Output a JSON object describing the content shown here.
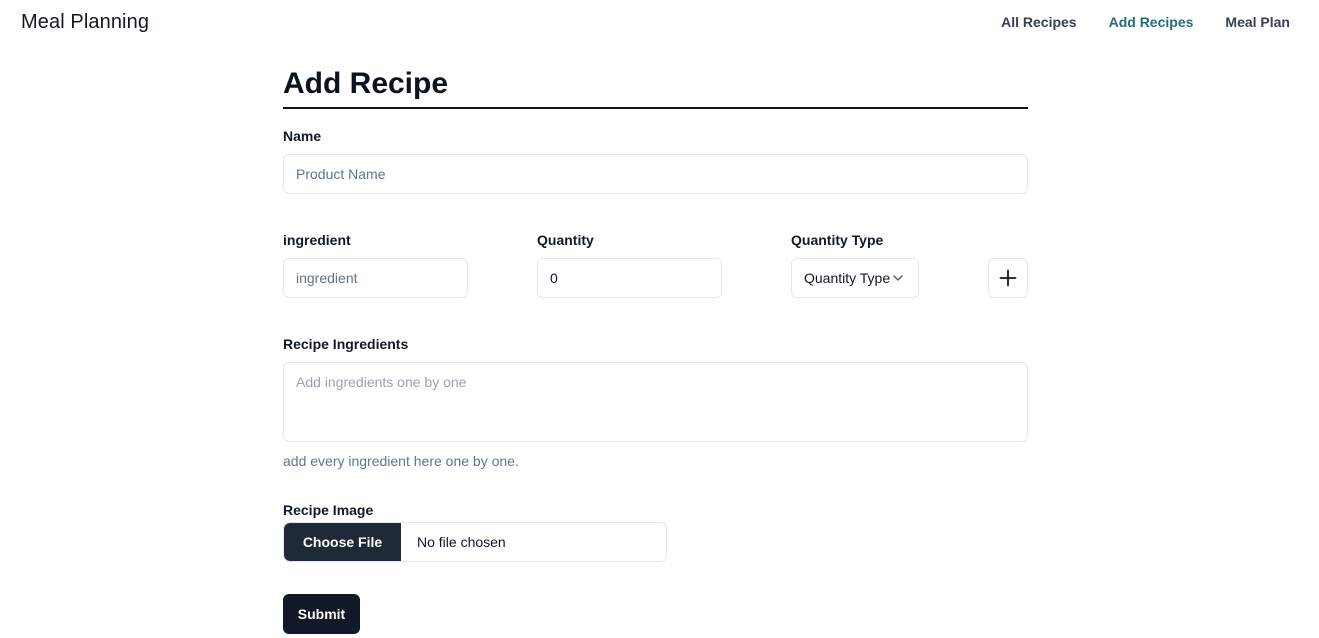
{
  "header": {
    "brand": "Meal Planning",
    "nav": [
      {
        "label": "All Recipes",
        "active": false
      },
      {
        "label": "Add Recipes",
        "active": true
      },
      {
        "label": "Meal Plan",
        "active": false
      }
    ]
  },
  "form": {
    "title": "Add Recipe",
    "name": {
      "label": "Name",
      "placeholder": "Product Name",
      "value": ""
    },
    "ingredient": {
      "label": "ingredient",
      "placeholder": "ingredient",
      "value": ""
    },
    "quantity": {
      "label": "Quantity",
      "value": "0"
    },
    "quantity_type": {
      "label": "Quantity Type",
      "selected": "Quantity Type"
    },
    "add_button_icon": "plus-icon",
    "recipe_ingredients": {
      "label": "Recipe Ingredients",
      "placeholder": "Add ingredients one by one",
      "help": "add every ingredient here one by one."
    },
    "recipe_image": {
      "label": "Recipe Image",
      "button": "Choose File",
      "status": "No file chosen"
    },
    "submit": "Submit"
  },
  "colors": {
    "accent": "#1e6e80",
    "primary_dark": "#111827",
    "border": "#e2e8f0"
  }
}
